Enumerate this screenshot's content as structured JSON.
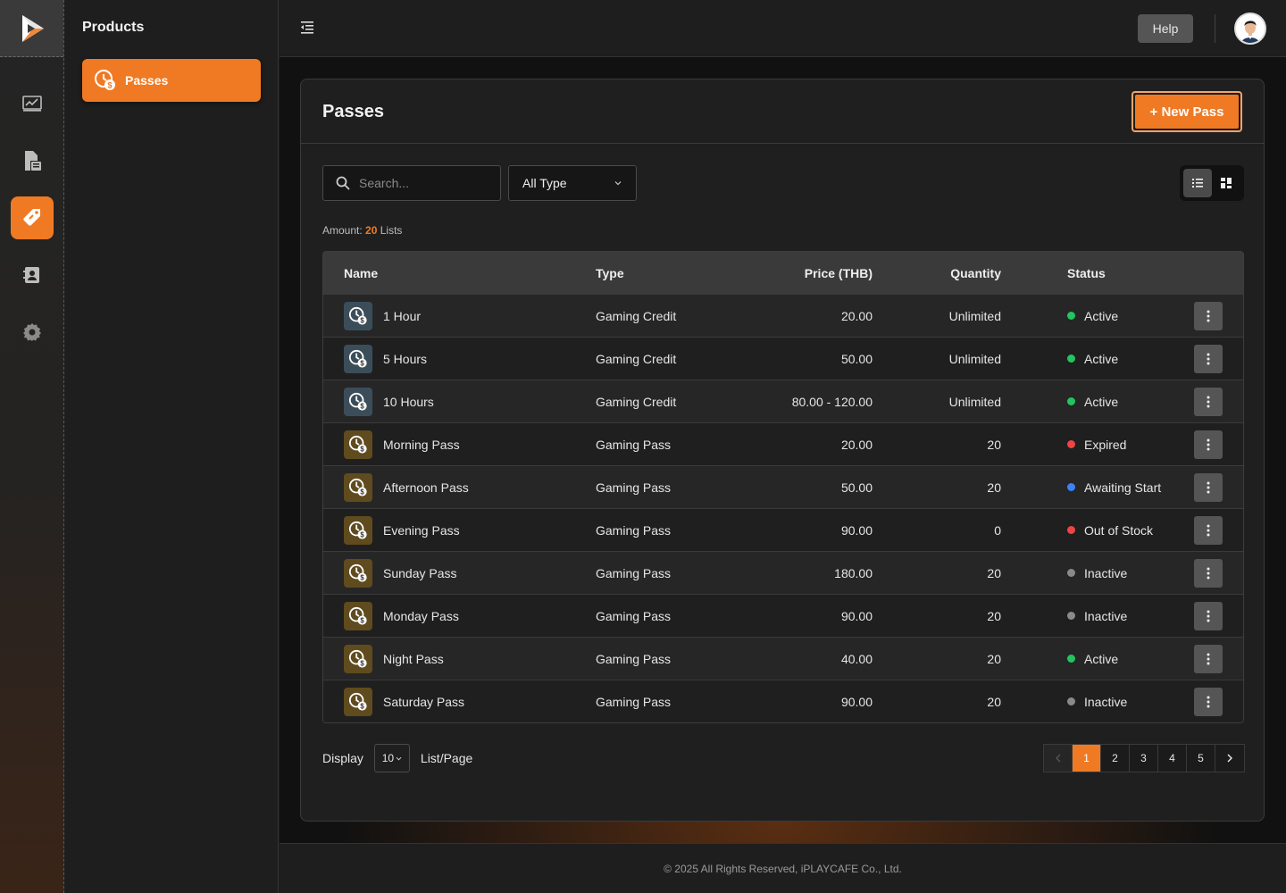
{
  "sidebar": {
    "title": "Products",
    "items": [
      {
        "label": "Passes",
        "icon": "pass-clock-icon"
      }
    ]
  },
  "rail": {
    "items": [
      "dashboard-chart-icon",
      "report-document-icon",
      "tag-icon",
      "user-card-icon",
      "settings-icon"
    ],
    "active": "tag-icon"
  },
  "topbar": {
    "help_label": "Help"
  },
  "page": {
    "title": "Passes",
    "new_button": "+ New Pass",
    "search_placeholder": "Search...",
    "type_filter": "All Type",
    "amount_label": "Amount:",
    "amount_value": "20",
    "amount_suffix": "Lists"
  },
  "table": {
    "columns": {
      "name": "Name",
      "type": "Type",
      "price": "Price (THB)",
      "quantity": "Quantity",
      "status": "Status"
    },
    "rows": [
      {
        "name": "1 Hour",
        "type": "Gaming Credit",
        "price": "20.00",
        "quantity": "Unlimited",
        "status": "Active"
      },
      {
        "name": "5 Hours",
        "type": "Gaming Credit",
        "price": "50.00",
        "quantity": "Unlimited",
        "status": "Active"
      },
      {
        "name": "10 Hours",
        "type": "Gaming Credit",
        "price": "80.00 - 120.00",
        "quantity": "Unlimited",
        "status": "Active"
      },
      {
        "name": "Morning Pass",
        "type": "Gaming Pass",
        "price": "20.00",
        "quantity": "20",
        "status": "Expired"
      },
      {
        "name": "Afternoon Pass",
        "type": "Gaming Pass",
        "price": "50.00",
        "quantity": "20",
        "status": "Awaiting Start"
      },
      {
        "name": "Evening Pass",
        "type": "Gaming Pass",
        "price": "90.00",
        "quantity": "0",
        "status": "Out of Stock"
      },
      {
        "name": "Sunday Pass",
        "type": "Gaming Pass",
        "price": "180.00",
        "quantity": "20",
        "status": "Inactive"
      },
      {
        "name": "Monday Pass",
        "type": "Gaming Pass",
        "price": "90.00",
        "quantity": "20",
        "status": "Inactive"
      },
      {
        "name": "Night Pass",
        "type": "Gaming Pass",
        "price": "40.00",
        "quantity": "20",
        "status": "Active"
      },
      {
        "name": "Saturday Pass",
        "type": "Gaming Pass",
        "price": "90.00",
        "quantity": "20",
        "status": "Inactive"
      }
    ]
  },
  "status_colors": {
    "Active": "#22c55e",
    "Expired": "#ef4444",
    "Awaiting Start": "#3b82f6",
    "Out of Stock": "#ef4444",
    "Inactive": "#8a8a8a"
  },
  "type_colors": {
    "Gaming Credit": "#3c4d5a",
    "Gaming Pass": "#5f4b1e"
  },
  "pagination": {
    "display_label": "Display",
    "per_page": "10",
    "per_page_suffix": "List/Page",
    "pages": [
      "1",
      "2",
      "3",
      "4",
      "5"
    ],
    "current": "1"
  },
  "footer": {
    "text": "© 2025 All Rights Reserved, iPLAYCAFE Co., Ltd."
  },
  "accent": "#f07a24"
}
